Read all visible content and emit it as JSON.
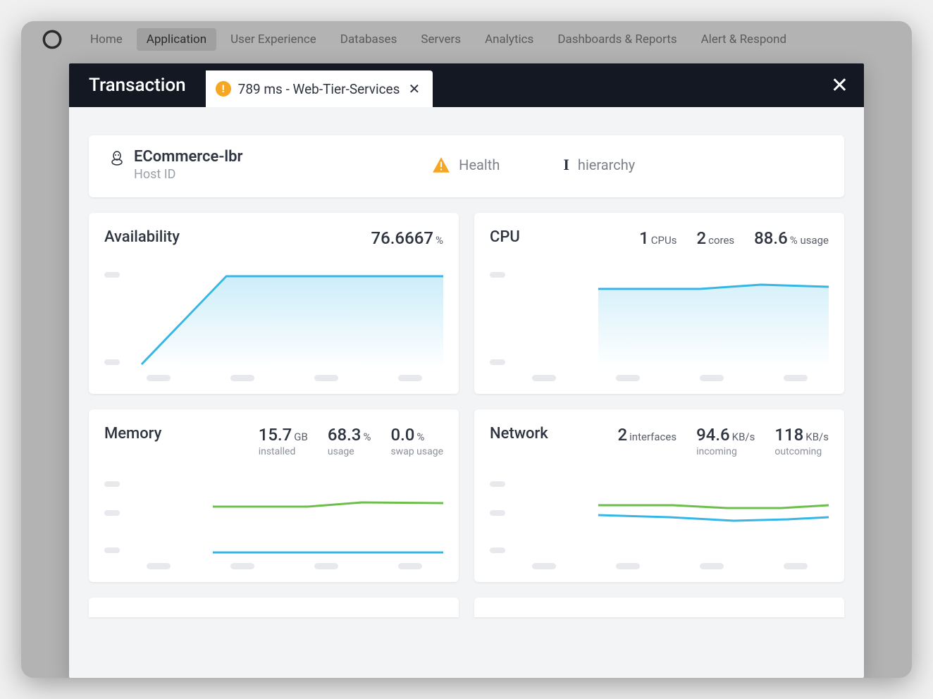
{
  "nav": {
    "items": [
      "Home",
      "Application",
      "User Experience",
      "Databases",
      "Servers",
      "Analytics",
      "Dashboards & Reports",
      "Alert & Respond"
    ],
    "active_index": 1
  },
  "modal": {
    "title": "Transaction",
    "tab_label": "789 ms - Web-Tier-Services"
  },
  "host": {
    "name": "ECommerce-lbr",
    "sub": "Host ID",
    "health_label": "Health",
    "hierarchy_label": "hierarchy"
  },
  "cards": {
    "availability": {
      "title": "Availability",
      "value": "76.6667",
      "unit": "%"
    },
    "cpu": {
      "title": "CPU",
      "cpus_num": "1",
      "cpus_unit": "CPUs",
      "cores_num": "2",
      "cores_unit": "cores",
      "usage_num": "88.6",
      "usage_unit": "% usage"
    },
    "memory": {
      "title": "Memory",
      "installed_num": "15.7",
      "installed_unit": "GB",
      "installed_sub": "installed",
      "usage_num": "68.3",
      "usage_unit": "%",
      "usage_sub": "usage",
      "swap_num": "0.0",
      "swap_unit": "%",
      "swap_sub": "swap usage"
    },
    "network": {
      "title": "Network",
      "interfaces_num": "2",
      "interfaces_unit": "interfaces",
      "incoming_num": "94.6",
      "incoming_unit": "KB/s",
      "incoming_sub": "incoming",
      "outcoming_num": "118",
      "outcoming_unit": "KB/s",
      "outcoming_sub": "outcoming"
    }
  },
  "chart_data": [
    {
      "card": "availability",
      "type": "area",
      "series": [
        {
          "name": "availability",
          "color": "#35b6e6",
          "values": [
            0,
            76.7,
            76.7,
            76.7,
            76.7
          ]
        }
      ],
      "ylim": [
        0,
        100
      ]
    },
    {
      "card": "cpu",
      "type": "area",
      "series": [
        {
          "name": "usage",
          "color": "#35b6e6",
          "values": [
            null,
            88,
            88,
            90,
            89
          ]
        }
      ],
      "ylim": [
        0,
        100
      ]
    },
    {
      "card": "memory",
      "type": "line",
      "series": [
        {
          "name": "usage",
          "color": "#6cbf4b",
          "values": [
            null,
            67,
            67,
            69,
            69
          ]
        },
        {
          "name": "swap",
          "color": "#35b6e6",
          "values": [
            null,
            0,
            0,
            0,
            0
          ]
        }
      ],
      "ylim": [
        0,
        100
      ]
    },
    {
      "card": "network",
      "type": "line",
      "series": [
        {
          "name": "outcoming",
          "color": "#6cbf4b",
          "values": [
            null,
            120,
            120,
            116,
            120
          ]
        },
        {
          "name": "incoming",
          "color": "#35b6e6",
          "values": [
            null,
            98,
            95,
            90,
            95
          ]
        }
      ],
      "ylim": [
        0,
        200
      ]
    }
  ]
}
